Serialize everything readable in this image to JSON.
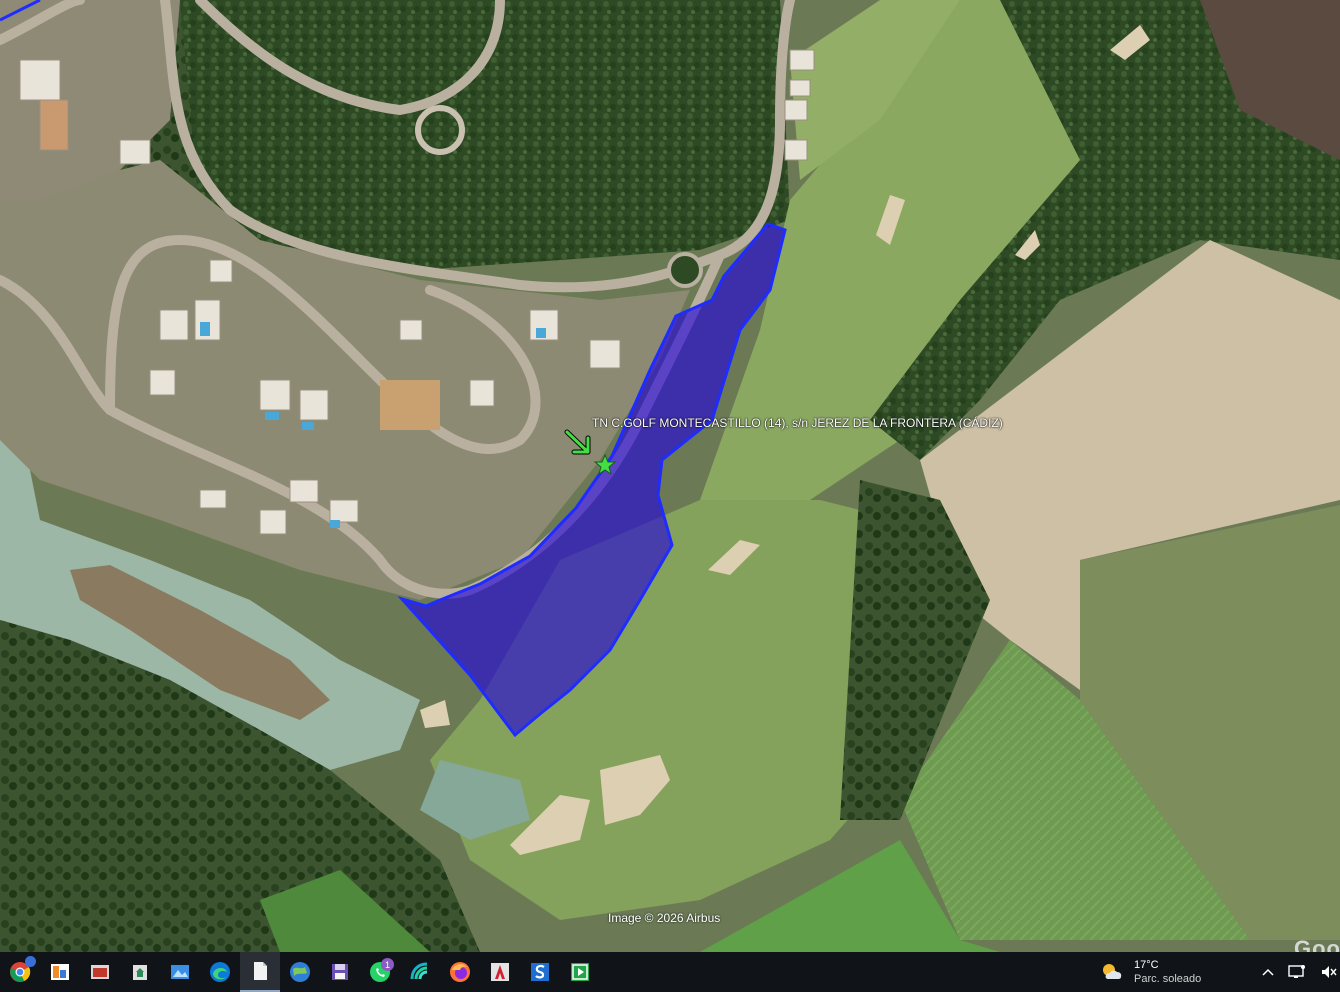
{
  "map": {
    "placemark_label": "TN C.GOLF MONTECASTILLO (14), s/n JEREZ DE LA FRONTERA (CÁDIZ)",
    "attribution": "Image © 2026 Airbus",
    "logo_text": "Goo",
    "parcel_fill": "#2200dd",
    "parcel_stroke": "#1f2cff",
    "placemark_color": "#44dd44"
  },
  "taskbar": {
    "apps": [
      {
        "name": "chrome-icon",
        "active": false
      },
      {
        "name": "photos-icon",
        "active": false
      },
      {
        "name": "snipping-tool-icon",
        "active": false
      },
      {
        "name": "recycle-icon",
        "active": false
      },
      {
        "name": "image-viewer-icon",
        "active": false
      },
      {
        "name": "edge-icon",
        "active": false
      },
      {
        "name": "document-icon",
        "active": true
      },
      {
        "name": "google-earth-icon",
        "active": false
      },
      {
        "name": "save-disk-icon",
        "active": false
      },
      {
        "name": "whatsapp-icon",
        "active": false,
        "badge": "1"
      },
      {
        "name": "signal-icon",
        "active": false
      },
      {
        "name": "firefox-icon",
        "active": false
      },
      {
        "name": "autocad-icon",
        "active": false
      },
      {
        "name": "s-app-icon",
        "active": false
      },
      {
        "name": "media-player-icon",
        "active": false
      }
    ],
    "weather": {
      "temperature": "17°C",
      "condition": "Parc. soleado"
    }
  }
}
